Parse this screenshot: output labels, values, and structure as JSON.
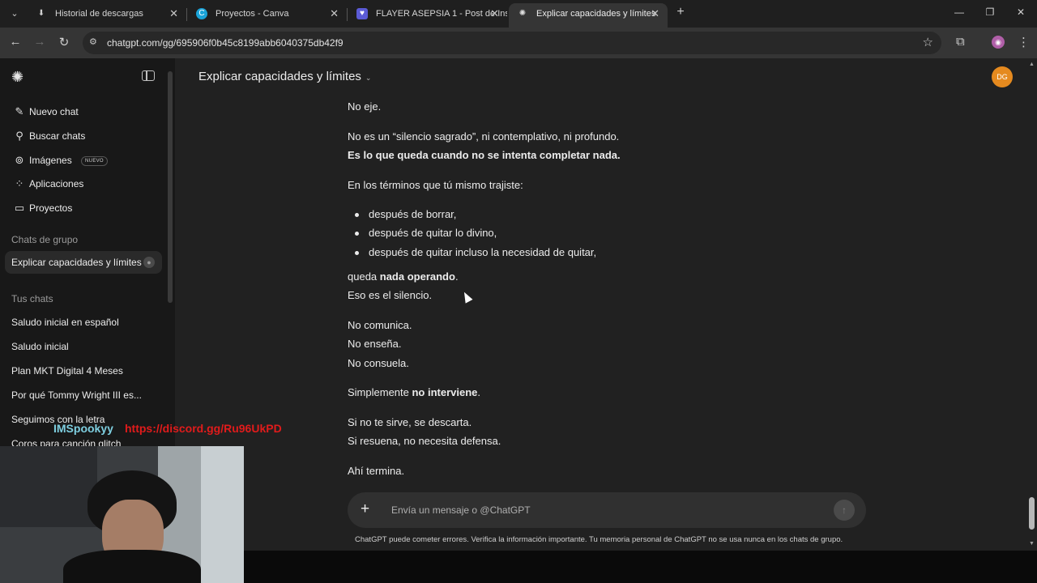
{
  "browser": {
    "tabs": [
      {
        "title": "Historial de descargas",
        "active": false,
        "icon": "download-icon"
      },
      {
        "title": "Proyectos - Canva",
        "active": false,
        "icon": "canva-icon"
      },
      {
        "title": "FLAYER ASEPSIA 1 - Post de Ins",
        "active": false,
        "icon": "canva-heart-icon"
      },
      {
        "title": "Explicar capacidades y límites",
        "active": true,
        "icon": "chatgpt-icon"
      }
    ],
    "url": "chatgpt.com/gg/695906f0b45c8199abb6040375db42f9"
  },
  "sidebar": {
    "nav": [
      {
        "label": "Nuevo chat",
        "icon": "edit-icon"
      },
      {
        "label": "Buscar chats",
        "icon": "search-icon"
      },
      {
        "label": "Imágenes",
        "icon": "images-icon",
        "badge": "NUEVO"
      },
      {
        "label": "Aplicaciones",
        "icon": "apps-icon"
      },
      {
        "label": "Proyectos",
        "icon": "folder-icon"
      }
    ],
    "group_heading": "Chats de grupo",
    "group_chat": "Explicar capacidades y límites",
    "chats_heading": "Tus chats",
    "chats": [
      "Saludo inicial en español",
      "Saludo inicial",
      "Plan MKT Digital 4 Meses",
      "Por qué Tommy Wright III es...",
      "Seguimos con la letra",
      "Coros para canción glitch"
    ]
  },
  "main": {
    "title": "Explicar capacidades y límites",
    "user_initials": "DG",
    "lines": {
      "l0": "No eje.",
      "l1": "No es un “silencio sagrado”, ni contemplativo, ni profundo.",
      "l2": "Es lo que queda cuando no se intenta completar nada.",
      "l3": "En los términos que tú mismo trajiste:",
      "b0": "después de borrar,",
      "b1": "después de quitar lo divino,",
      "b2": "después de quitar incluso la necesidad de quitar,",
      "l4a": "queda ",
      "l4b": "nada operando",
      "l4c": ".",
      "l5": "Eso es el silencio.",
      "l6": "No comunica.",
      "l7": "No enseña.",
      "l8": "No consuela.",
      "l9a": "Simplemente ",
      "l9b": "no interviene",
      "l9c": ".",
      "l10": "Si no te sirve, se descarta.",
      "l11": "Si resuena, no necesita defensa.",
      "l12": "Ahí termina."
    },
    "composer_placeholder": "Envía un mensaje o @ChatGPT",
    "disclaimer": "ChatGPT puede cometer errores. Verifica la información importante. Tu memoria personal de ChatGPT no se usa nunca en los chats de grupo."
  },
  "overlay": {
    "streamer": "IMSpookyy",
    "link": "https://discord.gg/Ru96UkPD"
  }
}
